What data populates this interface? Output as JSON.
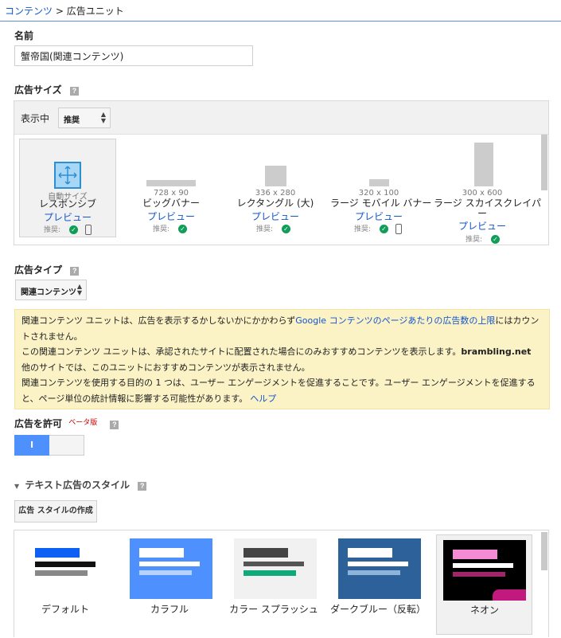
{
  "breadcrumb": {
    "root": "コンテンツ",
    "separator": ">",
    "current": "広告ユニット"
  },
  "name_section": {
    "label": "名前",
    "value": "蟹帝国(関連コンテンツ)"
  },
  "size_section": {
    "label": "広告サイズ",
    "filter_label": "表示中",
    "filter_value": "推奨",
    "cards": [
      {
        "type": "自動サイズ",
        "name": "レスポンシブ",
        "preview": "プレビュー",
        "rec": "推奨:"
      },
      {
        "dim": "728 x 90",
        "name": "ビッグバナー",
        "preview": "プレビュー",
        "rec": "推奨:"
      },
      {
        "dim": "336 x 280",
        "name": "レクタングル (大)",
        "preview": "プレビュー",
        "rec": "推奨:"
      },
      {
        "dim": "320 x 100",
        "name": "ラージ モバイル バナー",
        "preview": "プレビュー",
        "rec": "推奨:"
      },
      {
        "dim": "300 x 600",
        "name": "ラージ スカイスクレイパ",
        "name2": "ー",
        "preview": "プレビュー",
        "rec": "推奨:"
      }
    ]
  },
  "type_section": {
    "label": "広告タイプ",
    "value": "関連コンテンツ"
  },
  "notice": {
    "p1_before": "関連コンテンツ ユニットは、広告を表示するかしないかにかかわらず",
    "p1_link": "Google コンテンツのページあたりの広告数の上限",
    "p1_after": "にはカウントされません。",
    "p2_before": "この関連コンテンツ ユニットは、承認されたサイトに配置された場合にのみおすすめコンテンツを表示します。",
    "p2_site": "brambling.net",
    "p3": "他のサイトでは、このユニットにおすすめコンテンツが表示されません。",
    "p4": "関連コンテンツを使用する目的の 1 つは、ユーザー エンゲージメントを促進することです。ユーザー エンゲージメントを促進すると、ページ単位の統計情報に影響する可能性があります。",
    "p4_link": "ヘルプ"
  },
  "allow_ads": {
    "label": "広告を許可",
    "beta": "ベータ版",
    "toggle_on": "I"
  },
  "text_style": {
    "label": "テキスト広告のスタイル",
    "create_button": "広告 スタイルの作成",
    "styles": [
      {
        "name": "デフォルト"
      },
      {
        "name": "カラフル"
      },
      {
        "name": "カラー スプラッシュ"
      },
      {
        "name": "ダークブルー（反転）"
      },
      {
        "name": "ネオン"
      }
    ]
  },
  "help_icon": "?",
  "colors": {
    "link": "#1155cc",
    "toggle_on": "#4d90fe",
    "notice_bg": "#fbf2c6",
    "check": "#0f9d58"
  }
}
